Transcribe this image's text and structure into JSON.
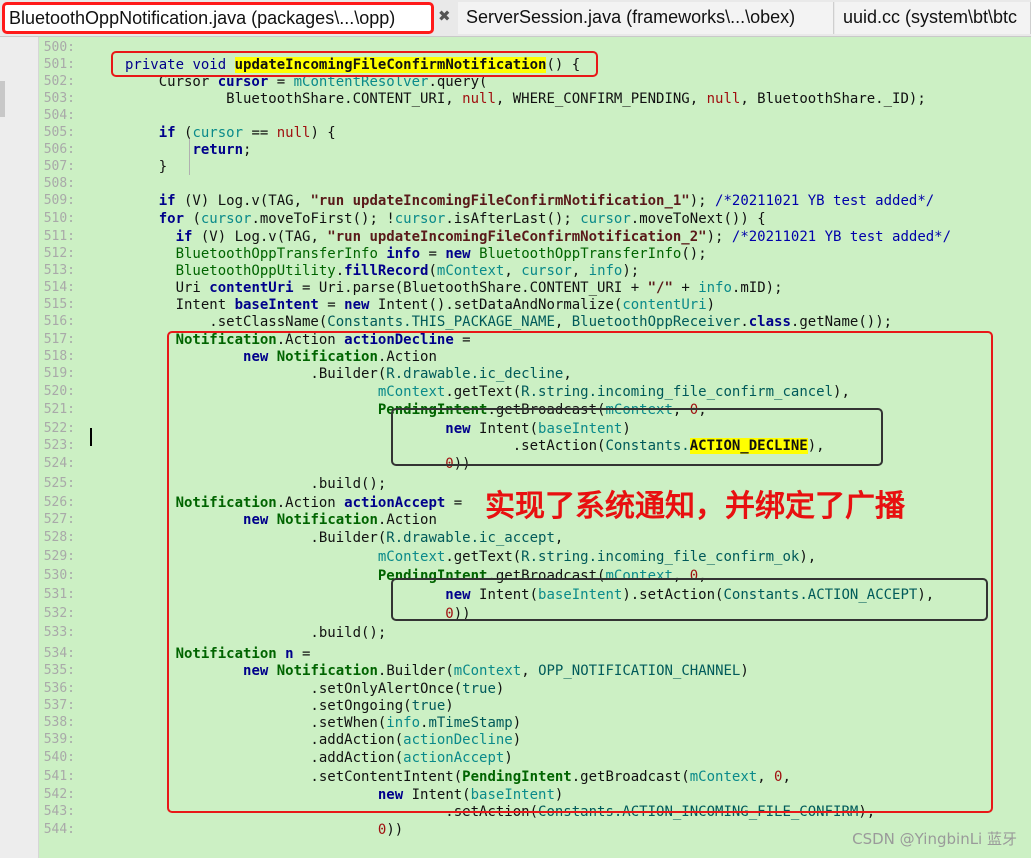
{
  "tabs": [
    {
      "label": "BluetoothOppNotification.java (packages\\...\\opp)",
      "active": true
    },
    {
      "label": "ServerSession.java (frameworks\\...\\obex)",
      "active": false
    },
    {
      "label": "uuid.cc (system\\bt\\btc",
      "active": false
    }
  ],
  "editor": {
    "lines": [
      {
        "num": "500",
        "html": ""
      },
      {
        "num": "501",
        "html": "<span class=\"d\">private</span> <span class=\"d\">void</span> <span class=\"hl\">updateIncomingFileConfirmNotification</span>() {"
      },
      {
        "num": "502",
        "html": "    Cursor <span class=\"k\">cursor</span> = <span class=\"v\">mContentResolver</span>.query("
      },
      {
        "num": "503",
        "html": "            BluetoothShare.CONTENT_URI, <span class=\"n\">null</span>, WHERE_CONFIRM_PENDING, <span class=\"n\">null</span>, BluetoothShare._ID);"
      },
      {
        "num": "504",
        "html": ""
      },
      {
        "num": "505",
        "html": "    <span class=\"k\">if</span> (<span class=\"v\">cursor</span> == <span class=\"n\">null</span>) {"
      },
      {
        "num": "506",
        "html": "        <span class=\"k\">return</span>;"
      },
      {
        "num": "507",
        "html": "    }"
      },
      {
        "num": "508",
        "html": ""
      },
      {
        "num": "509",
        "html": "    <span class=\"k\">if</span> (V) Log.v(TAG, <span class=\"s\">\"run updateIncomingFileConfirmNotification_1\"</span>); <span class=\"c\">/*20211021 YB test added*/</span>"
      },
      {
        "num": "510",
        "html": "    <span class=\"k\">for</span> (<span class=\"v\">cursor</span>.moveToFirst(); !<span class=\"v\">cursor</span>.isAfterLast(); <span class=\"v\">cursor</span>.moveToNext()) {"
      },
      {
        "num": "511",
        "html": "      <span class=\"k\">if</span> (V) Log.v(TAG, <span class=\"s\">\"run updateIncomingFileConfirmNotification_2\"</span>); <span class=\"c\">/*20211021 YB test added*/</span>"
      },
      {
        "num": "512",
        "html": "      <span class=\"cls\">BluetoothOppTransferInfo</span> <span class=\"k\">info</span> = <span class=\"k\">new</span> <span class=\"cls\">BluetoothOppTransferInfo</span>();"
      },
      {
        "num": "513",
        "html": "      <span class=\"cls\">BluetoothOppUtility</span>.<span class=\"k\">fillRecord</span>(<span class=\"v\">mContext</span>, <span class=\"v\">cursor</span>, <span class=\"v\">info</span>);"
      },
      {
        "num": "514",
        "html": "      Uri <span class=\"k\">contentUri</span> = Uri.parse(BluetoothShare.CONTENT_URI + <span class=\"s\">\"/\"</span> + <span class=\"v\">info</span>.mID);"
      },
      {
        "num": "515",
        "html": "      Intent <span class=\"k\">baseIntent</span> = <span class=\"k\">new</span> Intent().setDataAndNormalize(<span class=\"v\">contentUri</span>)"
      },
      {
        "num": "516",
        "html": "          .setClassName(<span class=\"m\">Constants.THIS_PACKAGE_NAME</span>, <span class=\"m\">BluetoothOppReceiver</span>.<span class=\"k\">class</span>.getName());"
      },
      {
        "num": "517",
        "html": "      <span class=\"ty\">Notification</span>.Action <span class=\"k\">actionDecline</span> ="
      },
      {
        "num": "518",
        "html": "              <span class=\"k\">new</span> <span class=\"ty\">Notification</span>.Action"
      },
      {
        "num": "519",
        "html": "                      .Builder(<span class=\"m\">R.drawable.ic_decline</span>,"
      },
      {
        "num": "520",
        "html": "                              <span class=\"v\">mContext</span>.getText(<span class=\"m\">R.string.incoming_file_confirm_cancel</span>),"
      },
      {
        "num": "521",
        "html": "                              <span class=\"ty\">PendingIntent</span>.getBroadcast(<span class=\"v\">mContext</span>, <span class=\"n\">0</span>,"
      },
      {
        "num": "522",
        "html": "                                      <span class=\"k\">new</span> Intent(<span class=\"v\">baseIntent</span>)"
      },
      {
        "num": "523",
        "html": "                                              .setAction(<span class=\"m\">Constants.</span><span class=\"hl\">ACTION_DECLINE</span>),"
      },
      {
        "num": "524",
        "html": "                                      <span class=\"n\">0</span>))"
      },
      {
        "num": "525",
        "html": "                      .build();"
      },
      {
        "num": "526",
        "html": "      <span class=\"ty\">Notification</span>.Action <span class=\"k\">actionAccept</span> ="
      },
      {
        "num": "527",
        "html": "              <span class=\"k\">new</span> <span class=\"ty\">Notification</span>.Action"
      },
      {
        "num": "528",
        "html": "                      .Builder(<span class=\"m\">R.drawable.ic_accept</span>,"
      },
      {
        "num": "529",
        "html": "                              <span class=\"v\">mContext</span>.getText(<span class=\"m\">R.string.incoming_file_confirm_ok</span>),"
      },
      {
        "num": "530",
        "html": "                              <span class=\"ty\">PendingIntent</span>.getBroadcast(<span class=\"v\">mContext</span>, <span class=\"n\">0</span>,"
      },
      {
        "num": "531",
        "html": "                                      <span class=\"k\">new</span> Intent(<span class=\"v\">baseIntent</span>).setAction(<span class=\"m\">Constants.ACTION_ACCEPT</span>),"
      },
      {
        "num": "532",
        "html": "                                      <span class=\"n\">0</span>))"
      },
      {
        "num": "533",
        "html": "                      .build();"
      },
      {
        "num": "534",
        "html": "      <span class=\"ty\">Notification</span> <span class=\"k\">n</span> ="
      },
      {
        "num": "535",
        "html": "              <span class=\"k\">new</span> <span class=\"ty\">Notification</span>.Builder(<span class=\"v\">mContext</span>, <span class=\"m\">OPP_NOTIFICATION_CHANNEL</span>)"
      },
      {
        "num": "536",
        "html": "                      .setOnlyAlertOnce(<span class=\"m\">true</span>)"
      },
      {
        "num": "537",
        "html": "                      .setOngoing(<span class=\"m\">true</span>)"
      },
      {
        "num": "538",
        "html": "                      .setWhen(<span class=\"v\">info</span>.<span class=\"m\">mTimeStamp</span>)"
      },
      {
        "num": "539",
        "html": "                      .addAction(<span class=\"v\">actionDecline</span>)"
      },
      {
        "num": "540",
        "html": "                      .addAction(<span class=\"v\">actionAccept</span>)"
      },
      {
        "num": "541",
        "html": "                      .setContentIntent(<span class=\"ty\">PendingIntent</span>.getBroadcast(<span class=\"v\">mContext</span>, <span class=\"n\">0</span>,"
      },
      {
        "num": "542",
        "html": "                              <span class=\"k\">new</span> Intent(<span class=\"v\">baseIntent</span>)"
      },
      {
        "num": "543",
        "html": "                                      .setAction(<span class=\"m\">Constants.ACTION_INCOMING_FILE_CONFIRM</span>),"
      },
      {
        "num": "544",
        "html": "                              <span class=\"n\">0</span>))"
      }
    ]
  },
  "annotation": "实现了系统通知，并绑定了广播",
  "watermark": "CSDN @YingbinLi 蓝牙",
  "colors": {
    "editor_bg": "#ccf0c4",
    "annotation": "#e81010",
    "highlight": "#ffff00"
  }
}
